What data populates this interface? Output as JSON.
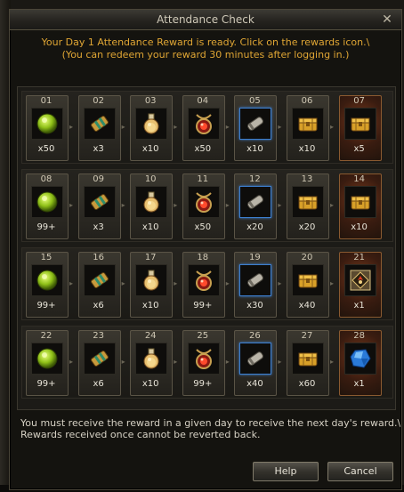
{
  "window": {
    "title": "Attendance Check",
    "close_glyph": "✕"
  },
  "notice": {
    "line1": "Your Day 1 Attendance Reward is ready. Click on the rewards icon.\\",
    "line2": "(You can redeem your reward 30 minutes after logging in.)"
  },
  "days": [
    {
      "day": "01",
      "item": "green-gem-icon",
      "qty": "x50"
    },
    {
      "day": "02",
      "item": "scroll-icon",
      "qty": "x3"
    },
    {
      "day": "03",
      "item": "potion-icon",
      "qty": "x10"
    },
    {
      "day": "04",
      "item": "amulet-icon",
      "qty": "x50"
    },
    {
      "day": "05",
      "item": "blue-scroll-icon",
      "qty": "x10"
    },
    {
      "day": "06",
      "item": "chest-icon",
      "qty": "x10"
    },
    {
      "day": "07",
      "item": "chest-icon",
      "qty": "x5",
      "special": true
    },
    {
      "day": "08",
      "item": "green-gem-icon",
      "qty": "99+"
    },
    {
      "day": "09",
      "item": "scroll-icon",
      "qty": "x3"
    },
    {
      "day": "10",
      "item": "potion-icon",
      "qty": "x10"
    },
    {
      "day": "11",
      "item": "amulet-icon",
      "qty": "x50"
    },
    {
      "day": "12",
      "item": "blue-scroll-icon",
      "qty": "x20"
    },
    {
      "day": "13",
      "item": "chest-icon",
      "qty": "x20"
    },
    {
      "day": "14",
      "item": "chest-icon",
      "qty": "x10",
      "special": true
    },
    {
      "day": "15",
      "item": "green-gem-icon",
      "qty": "99+"
    },
    {
      "day": "16",
      "item": "scroll-icon",
      "qty": "x6"
    },
    {
      "day": "17",
      "item": "potion-icon",
      "qty": "x10"
    },
    {
      "day": "18",
      "item": "amulet-icon",
      "qty": "99+"
    },
    {
      "day": "19",
      "item": "blue-scroll-icon",
      "qty": "x30"
    },
    {
      "day": "20",
      "item": "chest-icon",
      "qty": "x40"
    },
    {
      "day": "21",
      "item": "rune-icon",
      "qty": "x1",
      "special": true
    },
    {
      "day": "22",
      "item": "green-gem-icon",
      "qty": "99+"
    },
    {
      "day": "23",
      "item": "scroll-icon",
      "qty": "x6"
    },
    {
      "day": "24",
      "item": "potion-icon",
      "qty": "x10"
    },
    {
      "day": "25",
      "item": "amulet-icon",
      "qty": "99+"
    },
    {
      "day": "26",
      "item": "blue-scroll-icon",
      "qty": "x40"
    },
    {
      "day": "27",
      "item": "chest-icon",
      "qty": "x60"
    },
    {
      "day": "28",
      "item": "blue-crystal-icon",
      "qty": "x1",
      "special": true
    }
  ],
  "footer": {
    "line1": "You must receive the reward in a given day to receive the next day's reward.\\",
    "line2": "Rewards received once cannot be reverted back."
  },
  "buttons": {
    "help_label": "Help",
    "cancel_label": "Cancel"
  },
  "colors": {
    "notice_text": "#e0a634",
    "title_text": "#cfc9b8",
    "highlight_border": "#3d7fd0"
  }
}
